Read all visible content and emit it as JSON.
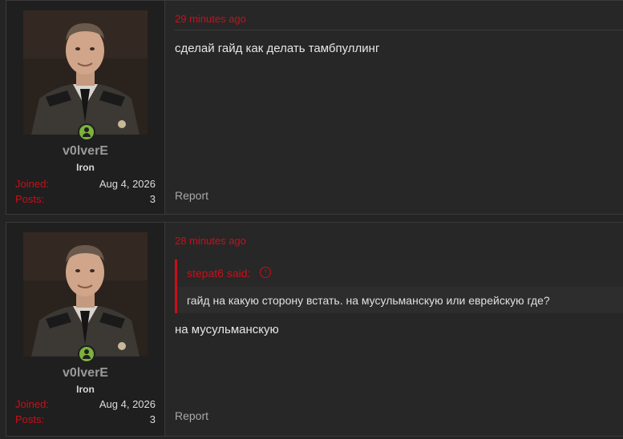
{
  "posts": [
    {
      "author": "v0lverE",
      "rank": "Iron",
      "joined_label": "Joined:",
      "joined_value": "Aug 4, 2026",
      "posts_label": "Posts:",
      "posts_value": "3",
      "time": "29 minutes ago",
      "message": "сделай гайд как делать тамбпуллинг",
      "report_label": "Report"
    },
    {
      "author": "v0lverE",
      "rank": "Iron",
      "joined_label": "Joined:",
      "joined_value": "Aug 4, 2026",
      "posts_label": "Posts:",
      "posts_value": "3",
      "time": "28 minutes ago",
      "quote": {
        "author": "stepat6 said:",
        "arrow_icon": "arrow-up-circle-icon",
        "text": "гайд на какую сторону встать. на мусульманскую или еврейскую где?"
      },
      "message": "на мусульманскую",
      "report_label": "Report"
    }
  ],
  "colors": {
    "accent": "#c8101a",
    "online": "#7cb33a",
    "background": "#242424"
  }
}
